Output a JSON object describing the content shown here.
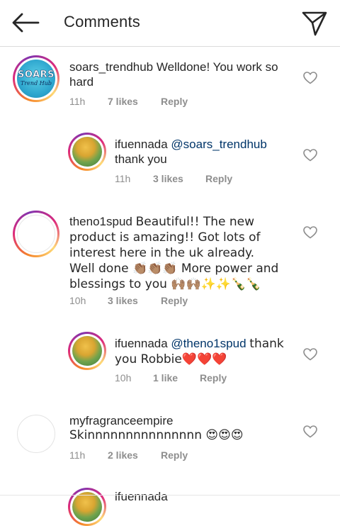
{
  "header": {
    "title": "Comments",
    "back_icon": "arrow-left-icon",
    "send_icon": "paper-plane-icon"
  },
  "comments": [
    {
      "username": "soars_trendhub",
      "text": "Welldone! You work so hard",
      "time": "11h",
      "likes": "7 likes",
      "reply": "Reply",
      "avatar": {
        "line1": "SOARS",
        "line2": "Trend Hub"
      }
    },
    {
      "username": "ifuennada",
      "mention": "@soars_trendhub",
      "text": "thank you",
      "time": "11h",
      "likes": "3 likes",
      "reply": "Reply"
    },
    {
      "username": "theno1spud",
      "text": "Beautiful!! The new product is amazing!! Got lots of interest here in the uk already. Well done 👏🏽👏🏽👏🏽 More power and blessings to you 🙌🏽🙌🏽✨✨🍾🍾",
      "time": "10h",
      "likes": "3 likes",
      "reply": "Reply"
    },
    {
      "username": "ifuennada",
      "mention": "@theno1spud",
      "text": "thank you Robbie❤️❤️❤️",
      "time": "10h",
      "likes": "1 like",
      "reply": "Reply"
    },
    {
      "username": "myfragranceempire",
      "text": "Skinnnnnnnnnnnnnnn 😍😍😍",
      "time": "11h",
      "likes": "2 likes",
      "reply": "Reply"
    },
    {
      "username": "ifuennada"
    }
  ],
  "colors": {
    "text": "#262626",
    "meta": "#8e8e8e",
    "mention": "#003569"
  }
}
